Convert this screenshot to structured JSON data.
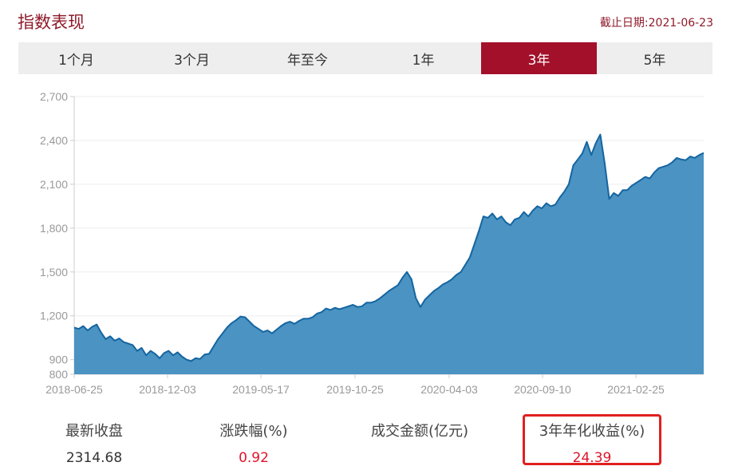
{
  "header": {
    "title": "指数表现",
    "as_of_label": "截止日期:2021-06-23"
  },
  "tabs": [
    {
      "label": "1个月",
      "active": false
    },
    {
      "label": "3个月",
      "active": false
    },
    {
      "label": "年至今",
      "active": false
    },
    {
      "label": "1年",
      "active": false
    },
    {
      "label": "3年",
      "active": true
    },
    {
      "label": "5年",
      "active": false
    }
  ],
  "chart_data": {
    "type": "area",
    "title": "",
    "xlabel": "",
    "ylabel": "",
    "ylim": [
      800,
      2700
    ],
    "y_ticks": [
      800,
      900,
      1200,
      1500,
      1800,
      2100,
      2400,
      2700
    ],
    "y_tick_labels": [
      "800",
      "900",
      "1,200",
      "1,500",
      "1,800",
      "2,100",
      "2,400",
      "2,700"
    ],
    "x_tick_labels": [
      "2018-06-25",
      "2018-12-03",
      "2019-05-17",
      "2019-10-25",
      "2020-04-03",
      "2020-09-10",
      "2021-02-25"
    ],
    "grid": true,
    "colors": {
      "line": "#1565a0",
      "fill": "#4a93c2"
    },
    "series": [
      {
        "values": [
          1120,
          1110,
          1130,
          1100,
          1125,
          1140,
          1085,
          1040,
          1060,
          1030,
          1045,
          1020,
          1010,
          1000,
          960,
          980,
          930,
          960,
          940,
          910,
          945,
          960,
          930,
          950,
          920,
          900,
          890,
          910,
          905,
          935,
          940,
          990,
          1040,
          1080,
          1120,
          1150,
          1170,
          1195,
          1190,
          1160,
          1130,
          1110,
          1090,
          1100,
          1080,
          1105,
          1130,
          1150,
          1160,
          1145,
          1165,
          1180,
          1180,
          1190,
          1215,
          1225,
          1250,
          1240,
          1255,
          1245,
          1255,
          1265,
          1275,
          1260,
          1265,
          1290,
          1290,
          1300,
          1320,
          1345,
          1370,
          1390,
          1410,
          1460,
          1500,
          1450,
          1320,
          1260,
          1310,
          1340,
          1370,
          1390,
          1415,
          1430,
          1450,
          1480,
          1500,
          1550,
          1600,
          1690,
          1780,
          1880,
          1870,
          1900,
          1860,
          1880,
          1840,
          1820,
          1860,
          1870,
          1910,
          1880,
          1920,
          1950,
          1935,
          1970,
          1950,
          1960,
          2010,
          2050,
          2100,
          2230,
          2270,
          2310,
          2390,
          2300,
          2380,
          2440,
          2240,
          2000,
          2040,
          2020,
          2060,
          2060,
          2090,
          2110,
          2130,
          2150,
          2140,
          2180,
          2210,
          2220,
          2230,
          2250,
          2280,
          2270,
          2265,
          2290,
          2280,
          2300,
          2314.68
        ]
      }
    ]
  },
  "stats": [
    {
      "label": "最新收盘",
      "value": "2314.68",
      "color": "#333333"
    },
    {
      "label": "涨跌幅(%)",
      "value": "0.92",
      "color": "#e0142a"
    },
    {
      "label": "成交金额(亿元)",
      "value": "",
      "color": "#333333"
    },
    {
      "label": "3年年化收益(%)",
      "value": "24.39",
      "color": "#e0142a",
      "highlighted": true
    }
  ]
}
